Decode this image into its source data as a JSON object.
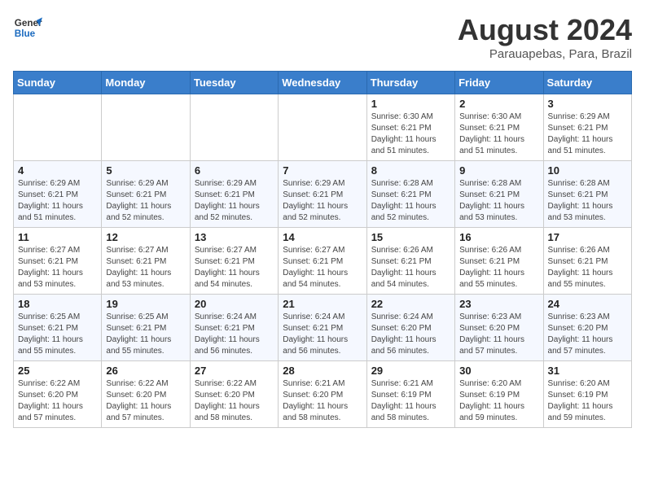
{
  "logo": {
    "line1": "General",
    "line2": "Blue"
  },
  "header": {
    "title": "August 2024",
    "subtitle": "Parauapebas, Para, Brazil"
  },
  "weekdays": [
    "Sunday",
    "Monday",
    "Tuesday",
    "Wednesday",
    "Thursday",
    "Friday",
    "Saturday"
  ],
  "weeks": [
    [
      {
        "day": "",
        "info": ""
      },
      {
        "day": "",
        "info": ""
      },
      {
        "day": "",
        "info": ""
      },
      {
        "day": "",
        "info": ""
      },
      {
        "day": "1",
        "info": "Sunrise: 6:30 AM\nSunset: 6:21 PM\nDaylight: 11 hours\nand 51 minutes."
      },
      {
        "day": "2",
        "info": "Sunrise: 6:30 AM\nSunset: 6:21 PM\nDaylight: 11 hours\nand 51 minutes."
      },
      {
        "day": "3",
        "info": "Sunrise: 6:29 AM\nSunset: 6:21 PM\nDaylight: 11 hours\nand 51 minutes."
      }
    ],
    [
      {
        "day": "4",
        "info": "Sunrise: 6:29 AM\nSunset: 6:21 PM\nDaylight: 11 hours\nand 51 minutes."
      },
      {
        "day": "5",
        "info": "Sunrise: 6:29 AM\nSunset: 6:21 PM\nDaylight: 11 hours\nand 52 minutes."
      },
      {
        "day": "6",
        "info": "Sunrise: 6:29 AM\nSunset: 6:21 PM\nDaylight: 11 hours\nand 52 minutes."
      },
      {
        "day": "7",
        "info": "Sunrise: 6:29 AM\nSunset: 6:21 PM\nDaylight: 11 hours\nand 52 minutes."
      },
      {
        "day": "8",
        "info": "Sunrise: 6:28 AM\nSunset: 6:21 PM\nDaylight: 11 hours\nand 52 minutes."
      },
      {
        "day": "9",
        "info": "Sunrise: 6:28 AM\nSunset: 6:21 PM\nDaylight: 11 hours\nand 53 minutes."
      },
      {
        "day": "10",
        "info": "Sunrise: 6:28 AM\nSunset: 6:21 PM\nDaylight: 11 hours\nand 53 minutes."
      }
    ],
    [
      {
        "day": "11",
        "info": "Sunrise: 6:27 AM\nSunset: 6:21 PM\nDaylight: 11 hours\nand 53 minutes."
      },
      {
        "day": "12",
        "info": "Sunrise: 6:27 AM\nSunset: 6:21 PM\nDaylight: 11 hours\nand 53 minutes."
      },
      {
        "day": "13",
        "info": "Sunrise: 6:27 AM\nSunset: 6:21 PM\nDaylight: 11 hours\nand 54 minutes."
      },
      {
        "day": "14",
        "info": "Sunrise: 6:27 AM\nSunset: 6:21 PM\nDaylight: 11 hours\nand 54 minutes."
      },
      {
        "day": "15",
        "info": "Sunrise: 6:26 AM\nSunset: 6:21 PM\nDaylight: 11 hours\nand 54 minutes."
      },
      {
        "day": "16",
        "info": "Sunrise: 6:26 AM\nSunset: 6:21 PM\nDaylight: 11 hours\nand 55 minutes."
      },
      {
        "day": "17",
        "info": "Sunrise: 6:26 AM\nSunset: 6:21 PM\nDaylight: 11 hours\nand 55 minutes."
      }
    ],
    [
      {
        "day": "18",
        "info": "Sunrise: 6:25 AM\nSunset: 6:21 PM\nDaylight: 11 hours\nand 55 minutes."
      },
      {
        "day": "19",
        "info": "Sunrise: 6:25 AM\nSunset: 6:21 PM\nDaylight: 11 hours\nand 55 minutes."
      },
      {
        "day": "20",
        "info": "Sunrise: 6:24 AM\nSunset: 6:21 PM\nDaylight: 11 hours\nand 56 minutes."
      },
      {
        "day": "21",
        "info": "Sunrise: 6:24 AM\nSunset: 6:21 PM\nDaylight: 11 hours\nand 56 minutes."
      },
      {
        "day": "22",
        "info": "Sunrise: 6:24 AM\nSunset: 6:20 PM\nDaylight: 11 hours\nand 56 minutes."
      },
      {
        "day": "23",
        "info": "Sunrise: 6:23 AM\nSunset: 6:20 PM\nDaylight: 11 hours\nand 57 minutes."
      },
      {
        "day": "24",
        "info": "Sunrise: 6:23 AM\nSunset: 6:20 PM\nDaylight: 11 hours\nand 57 minutes."
      }
    ],
    [
      {
        "day": "25",
        "info": "Sunrise: 6:22 AM\nSunset: 6:20 PM\nDaylight: 11 hours\nand 57 minutes."
      },
      {
        "day": "26",
        "info": "Sunrise: 6:22 AM\nSunset: 6:20 PM\nDaylight: 11 hours\nand 57 minutes."
      },
      {
        "day": "27",
        "info": "Sunrise: 6:22 AM\nSunset: 6:20 PM\nDaylight: 11 hours\nand 58 minutes."
      },
      {
        "day": "28",
        "info": "Sunrise: 6:21 AM\nSunset: 6:20 PM\nDaylight: 11 hours\nand 58 minutes."
      },
      {
        "day": "29",
        "info": "Sunrise: 6:21 AM\nSunset: 6:19 PM\nDaylight: 11 hours\nand 58 minutes."
      },
      {
        "day": "30",
        "info": "Sunrise: 6:20 AM\nSunset: 6:19 PM\nDaylight: 11 hours\nand 59 minutes."
      },
      {
        "day": "31",
        "info": "Sunrise: 6:20 AM\nSunset: 6:19 PM\nDaylight: 11 hours\nand 59 minutes."
      }
    ]
  ]
}
